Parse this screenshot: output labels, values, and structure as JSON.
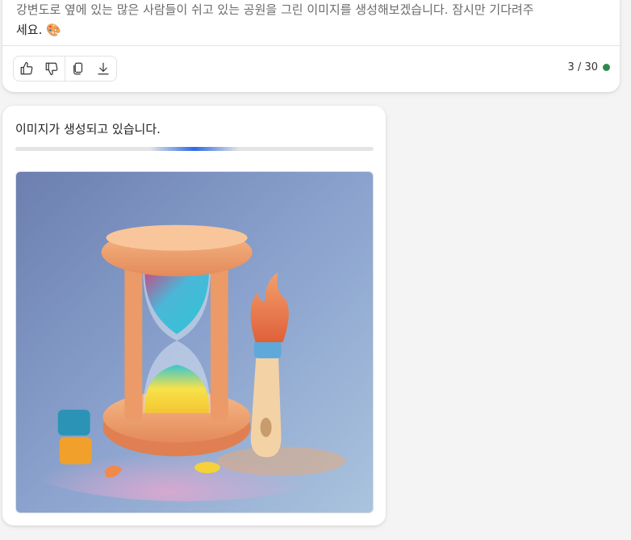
{
  "message": {
    "text_faded": "강변도로 옆에 있는 많은 사람들이 쉬고 있는 공원을 그린 이미지를 생성해보겠습니다. 잠시만 기다려주",
    "text_rest": "세요. 🎨"
  },
  "toolbar": {
    "like_icon": "thumbs-up-icon",
    "dislike_icon": "thumbs-down-icon",
    "copy_icon": "copy-icon",
    "download_icon": "download-icon"
  },
  "counter": {
    "text": "3 / 30",
    "status_color": "#2d8a4e"
  },
  "generation": {
    "status_text": "이미지가 생성되고 있습니다.",
    "progress": 0.5,
    "accent_color": "#2e6be6",
    "image_icon": "hourglass-paintbrush-placeholder-image"
  }
}
